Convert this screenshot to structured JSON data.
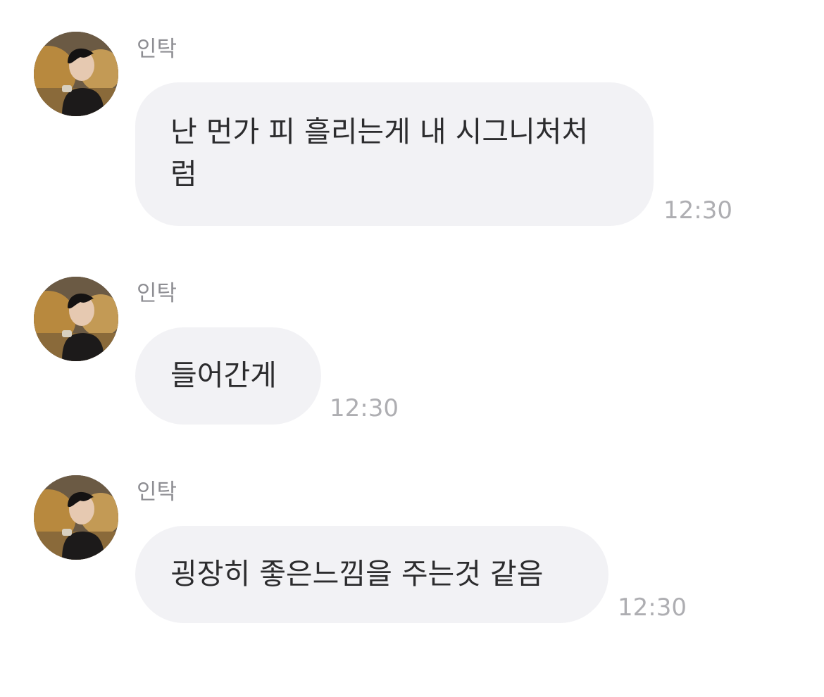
{
  "messages": [
    {
      "sender": "인탁",
      "text_line1": "난 먼가 피 흘리는게 내 시그니처처",
      "text_line2": "럼",
      "time": "12:30"
    },
    {
      "sender": "인탁",
      "text": "들어간게",
      "time": "12:30"
    },
    {
      "sender": "인탁",
      "text": "굉장히 좋은느낌을 주는것 같음",
      "time": "12:30"
    }
  ],
  "colors": {
    "bubble": "#f2f2f5",
    "sender": "#8e8e93",
    "time": "#aeaeb2",
    "text": "#2c2c2e"
  }
}
